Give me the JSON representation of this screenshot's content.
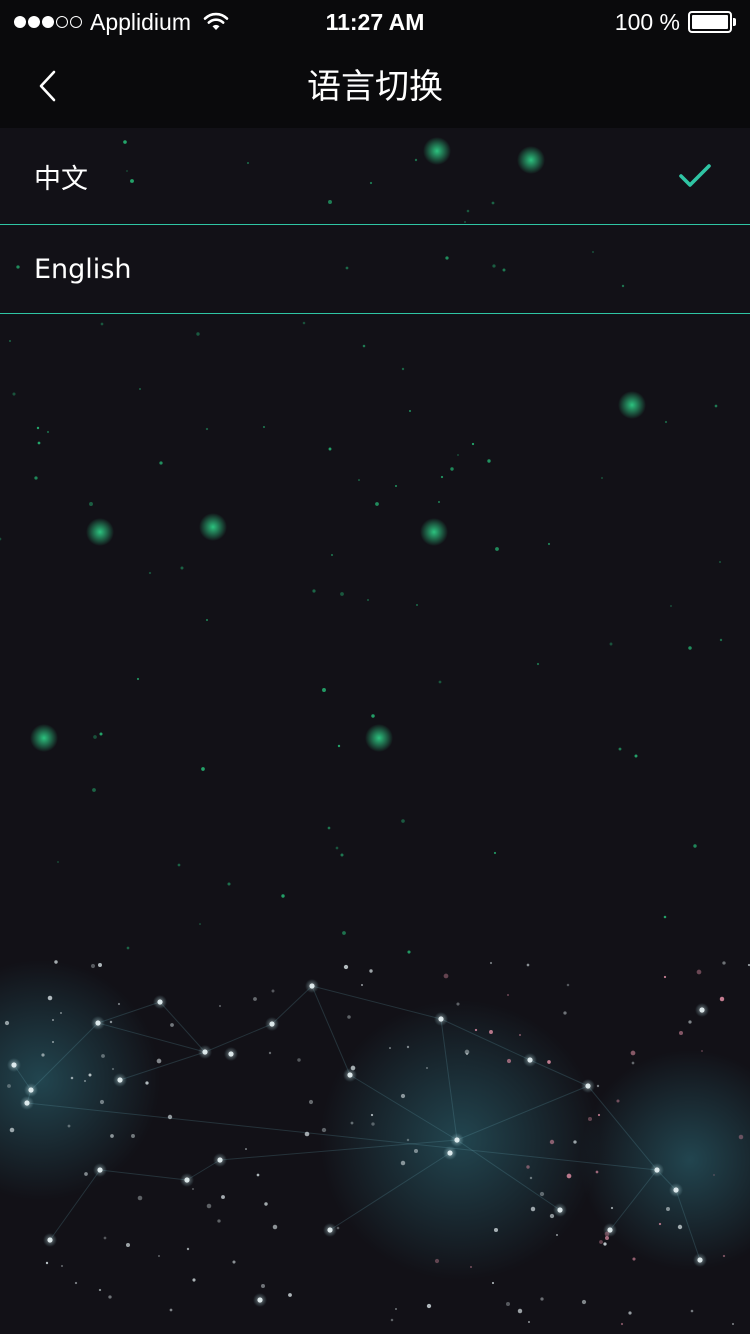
{
  "status_bar": {
    "signal_filled": 3,
    "signal_total": 5,
    "carrier": "Applidium",
    "time": "11:27 AM",
    "battery_text": "100 %",
    "battery_level": 1.0
  },
  "nav": {
    "title": "语言切换",
    "back_icon": "chevron-left-icon"
  },
  "languages": [
    {
      "label": "中文",
      "selected": true
    },
    {
      "label": "English",
      "selected": false
    }
  ],
  "colors": {
    "background": "#121117",
    "bar": "#0a0a0c",
    "accent": "#2fc5a4",
    "star_green": "#27c07a",
    "star_pink": "#d98aa0"
  }
}
